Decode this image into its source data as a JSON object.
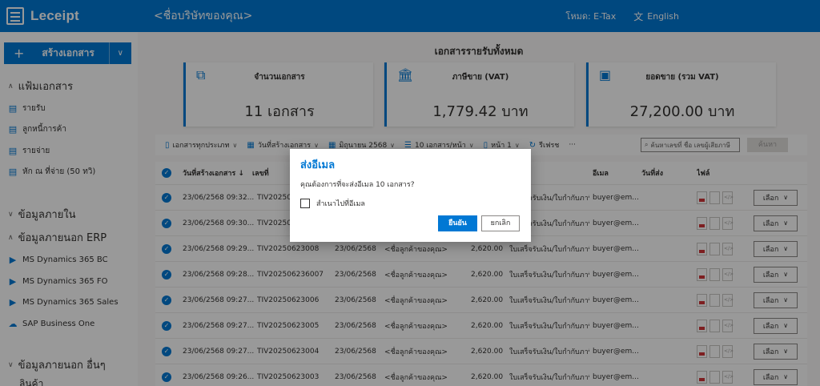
{
  "header": {
    "logo_text": "Leceipt",
    "company": "<ชื่อบริษัทของคุณ>",
    "mode": "โหมด: E-Tax",
    "language": "English"
  },
  "sidebar": {
    "create_label": "สร้างเอกสาร",
    "groups": [
      {
        "label": "แฟ้มเอกสาร",
        "caret": "^"
      },
      {
        "label": "ข้อมูลภายใน",
        "caret": "v"
      },
      {
        "label": "ข้อมูลภายนอก ERP",
        "caret": "^"
      },
      {
        "label": "ข้อมูลภายนอก อื่นๆ",
        "caret": "v"
      }
    ],
    "items": [
      {
        "label": "รายรับ",
        "icon": "document-icon"
      },
      {
        "label": "ลูกหนี้การค้า",
        "icon": "document-icon"
      },
      {
        "label": "รายจ่าย",
        "icon": "document-icon"
      },
      {
        "label": "หัก ณ ที่จ่าย (50 ทวิ)",
        "icon": "document-icon"
      },
      {
        "label": "MS Dynamics 365 BC",
        "icon": "dynamics-icon"
      },
      {
        "label": "MS Dynamics 365 FO",
        "icon": "dynamics-icon"
      },
      {
        "label": "MS Dynamics 365 Sales",
        "icon": "dynamics-icon"
      },
      {
        "label": "SAP Business One",
        "icon": "cloud-icon"
      }
    ],
    "cutoff_label": "ลินค้า"
  },
  "main": {
    "title": "เอกสารรายรับทั้งหมด",
    "cards": [
      {
        "label": "จำนวนเอกสาร",
        "value": "11 เอกสาร",
        "icon": "documents-icon"
      },
      {
        "label": "ภาษีขาย (VAT)",
        "value": "1,779.42 บาท",
        "icon": "bank-icon"
      },
      {
        "label": "ยอดขาย (รวม VAT)",
        "value": "27,200.00 บาท",
        "icon": "money-icon"
      }
    ],
    "toolbar": {
      "doc_type": "เอกสารทุกประเภท",
      "date_filter": "วันที่สร้างเอกสาร",
      "month": "มิถุนายน 2568",
      "page_size": "10 เอกสาร/หน้า",
      "page": "หน้า 1",
      "refresh": "รีเฟรช",
      "more": "···",
      "search_placeholder": "ค้นหาเลขที่ ชื่อ เลขผู้เสียภาษี",
      "search_button": "ค้นหา"
    },
    "table": {
      "headers": {
        "created": "วันที่สร้างเอกสาร ↓",
        "number": "เลขที่",
        "email": "อีเมล",
        "sent": "วันที่ส่ง",
        "file": "ไฟล์"
      },
      "rows": [
        {
          "created": "23/06/2568 09:32...",
          "number": "TIV2025062",
          "date": "",
          "customer": "",
          "amount": "",
          "doc_type": "ใบเสร็จรับเงิน/ใบกำกับภาษี",
          "email": "buyer@em..."
        },
        {
          "created": "23/06/2568 09:30...",
          "number": "TIV2025062",
          "date": "",
          "customer": "",
          "amount": "",
          "doc_type": "ใบเสร็จรับเงิน/ใบกำกับภาษี",
          "email": "buyer@em..."
        },
        {
          "created": "23/06/2568 09:29...",
          "number": "TIV20250623008",
          "date": "23/06/2568",
          "customer": "<ชื่อลูกค้าของคุณ>",
          "amount": "2,620.00",
          "doc_type": "ใบเสร็จรับเงิน/ใบกำกับภาษี",
          "email": "buyer@em..."
        },
        {
          "created": "23/06/2568 09:28...",
          "number": "TIV20250623600​7",
          "date": "23/06/2568",
          "customer": "<ชื่อลูกค้าของคุณ>",
          "amount": "2,620.00",
          "doc_type": "ใบเสร็จรับเงิน/ใบกำกับภาษี",
          "email": "buyer@em..."
        },
        {
          "created": "23/06/2568 09:27...",
          "number": "TIV20250623006",
          "date": "23/06/2568",
          "customer": "<ชื่อลูกค้าของคุณ>",
          "amount": "2,620.00",
          "doc_type": "ใบเสร็จรับเงิน/ใบกำกับภาษี",
          "email": "buyer@em..."
        },
        {
          "created": "23/06/2568 09:27...",
          "number": "TIV20250623005",
          "date": "23/06/2568",
          "customer": "<ชื่อลูกค้าของคุณ>",
          "amount": "2,620.00",
          "doc_type": "ใบเสร็จรับเงิน/ใบกำกับภาษี",
          "email": "buyer@em..."
        },
        {
          "created": "23/06/2568 09:27...",
          "number": "TIV20250623004",
          "date": "23/06/2568",
          "customer": "<ชื่อลูกค้าของคุณ>",
          "amount": "2,620.00",
          "doc_type": "ใบเสร็จรับเงิน/ใบกำกับภาษี",
          "email": "buyer@em..."
        },
        {
          "created": "23/06/2568 09:26...",
          "number": "TIV20250623003",
          "date": "23/06/2568",
          "customer": "<ชื่อลูกค้าของคุณ>",
          "amount": "2,620.00",
          "doc_type": "ใบเสร็จรับเงิน/ใบกำกับภาษี",
          "email": "buyer@em..."
        }
      ],
      "select_label": "เลือก"
    }
  },
  "dialog": {
    "title": "ส่งอีเมล",
    "message": "คุณต้องการที่จะส่งอีเมล 10 เอกสาร?",
    "checkbox_label": "สำเนาไปที่อีเมล",
    "checkbox_checked": false,
    "confirm_label": "ยืนยัน",
    "cancel_label": "ยกเลิก"
  },
  "colors": {
    "primary": "#0078d4",
    "overlay": "rgba(0,0,0,0.4)"
  }
}
